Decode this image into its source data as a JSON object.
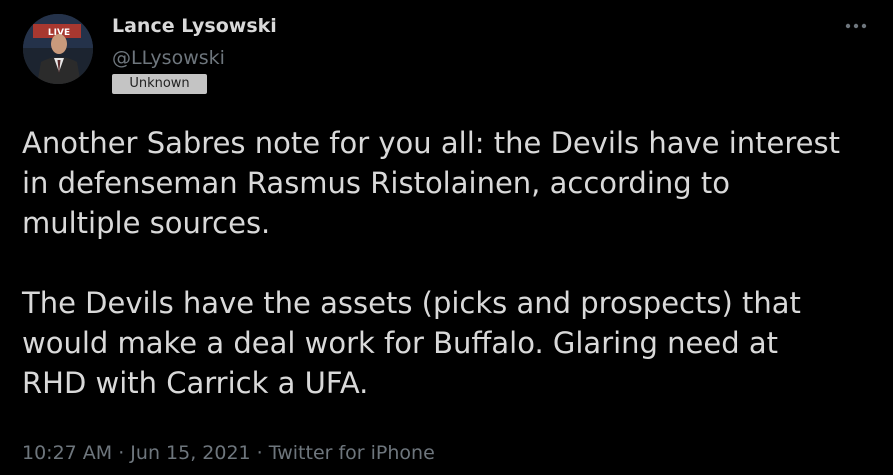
{
  "author": {
    "name": "Lance Lysowski",
    "handle": "@LLysowski",
    "label_badge": "Unknown"
  },
  "tweet": {
    "paragraph1": "Another Sabres note for you all: the Devils have interest\nin defenseman Rasmus Ristolainen, according to\nmultiple sources.",
    "paragraph2": "The Devils have the assets (picks and prospects) that\nwould make a deal work for Buffalo. Glaring need at\nRHD with Carrick a UFA.",
    "timestamp": "10:27 AM · Jun 15, 2021 · Twitter for iPhone"
  },
  "icons": {
    "more": "more-horizontal-icon",
    "avatar_logo_text": "LIVE"
  },
  "colors": {
    "background": "#000000",
    "primary_text": "#d9d9d9",
    "secondary_text": "#6e767d",
    "badge_bg": "#c4c4c4"
  }
}
